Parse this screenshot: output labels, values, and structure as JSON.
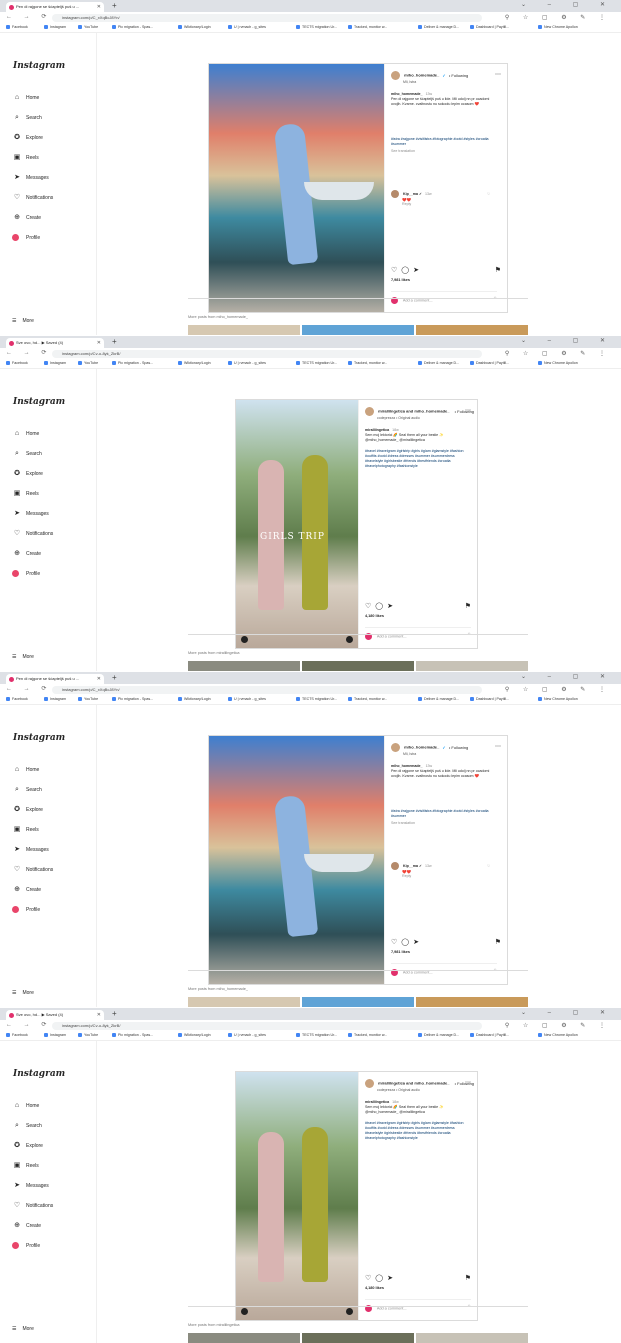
{
  "frames": [
    {
      "tab_title": "Pen di rajgone se šćapteljš puš u ...",
      "url": "instagram.com/p/C_xXqBcJ8Yn/",
      "post_user": "miho_homemade_",
      "post_verified": "✓",
      "follow": "• Following",
      "post_sub": "Mli, Istra",
      "caption_user": "miho_homemade_",
      "caption_time": "13w",
      "caption": "Pen di rajgone se šćapteljš puš u lide. Mli udolj nn pr ocadomi ovojih. Kvarne. cvaltnostu nu sokoolu lepim ocasom ❤️",
      "caption_tags": "#istra #rajgone #visitiistra #fotographie #ootd #styles #croatia #summer",
      "see_translation": "See translation",
      "reply_user": "Kip__ma ✓",
      "reply_time": "13w",
      "reply_emoji": "❤️❤️",
      "reply_link": "Reply",
      "likes": "7,981 likes",
      "comment_placeholder": "Add a comment...",
      "more_from": "More posts from miho_homemade_"
    },
    {
      "tab_title": "Sve ovo, hd... ▶ Saved (4)",
      "url": "instagram.com/p/Cv-o-8yk_ZkrB/",
      "post_user": "mirallilngetica and miho_homemade_",
      "post_verified": "",
      "follow": "• Following",
      "post_sub": "codeprezza • Original audio",
      "caption_user": "mirallilngetica",
      "caption_time": "18w",
      "caption": "Sem moj lektorici 🌈 Seal them all your bestie ✨ @miho_homemade_ @mirallilngetica",
      "caption_tags": "#travel #travelgram #girlstrip #girls #glam #glamstyle #fashion #outfits #ootd #dress #dresses #summer #summerdress #travelstyle #girlsbestie #friends #bestfriends #croatia #travelphotography #fashionstyle",
      "see_translation": "",
      "reply_user": "",
      "reply_time": "",
      "reply_emoji": "",
      "reply_link": "",
      "likes": "4,180 likes",
      "comment_placeholder": "Add a comment...",
      "more_from": "More posts from mirallilngetica",
      "overlay": "GIRLS TRIP"
    },
    {
      "tab_title": "Pen di rajgone se šćapteljš puš u ...",
      "url": "instagram.com/p/C_xXqBcJ8Yn/",
      "post_user": "miho_homemade_",
      "post_verified": "✓",
      "follow": "• Following",
      "post_sub": "Mli, Istra",
      "caption_user": "miho_homemade_",
      "caption_time": "13w",
      "caption": "Pen di rajgone se šćapteljš puš u lide. Mli udolj nn pr ocadomi ovojih. Kvarne. cvaltnostu nu sokoolu lepim ocasom ❤️",
      "caption_tags": "#istra #rajgone #visitiistra #fotographie #ootd #styles #croatia #summer",
      "see_translation": "See translation",
      "reply_user": "Kip__ma ✓",
      "reply_time": "13w",
      "reply_emoji": "❤️❤️",
      "reply_link": "Reply",
      "likes": "7,981 likes",
      "comment_placeholder": "Add a comment...",
      "more_from": "More posts from miho_homemade_"
    },
    {
      "tab_title": "Sve ovo, hd... ▶ Saved (4)",
      "url": "instagram.com/p/Cv-o-8yk_ZkrB/",
      "post_user": "mirallilngetica and miho_homemade_",
      "post_verified": "",
      "follow": "• Following",
      "post_sub": "codeprezza • Original audio",
      "caption_user": "mirallilngetica",
      "caption_time": "18w",
      "caption": "Sem moj lektorici 🌈 Seal them all your bestie ✨ @miho_homemade_ @mirallilngetica",
      "caption_tags": "#travel #travelgram #girlstrip #girls #glam #glamstyle #fashion #outfits #ootd #dress #dresses #summer #summerdress #travelstyle #girlsbestie #friends #bestfriends #croatia #travelphotography #fashionstyle",
      "see_translation": "",
      "reply_user": "",
      "reply_time": "",
      "reply_emoji": "",
      "reply_link": "",
      "likes": "4,180 likes",
      "comment_placeholder": "Add a comment...",
      "more_from": "More posts from mirallilngetica",
      "overlay": ""
    }
  ],
  "bookmarks": [
    "Facebook",
    "Instagram",
    "YouTube",
    "Pic migration - Spas...",
    "Wiktionary/Login",
    "U | rvmach - g_sites",
    "TECTS migration Ur...",
    "Tracked, monitor w...",
    "Deliver & manage D...",
    "Dashboard | Paytill...",
    "New Chrome Apollon"
  ],
  "brand": "Instagram",
  "nav": [
    {
      "icon": "⌂",
      "label": "Home"
    },
    {
      "icon": "⌕",
      "label": "Search"
    },
    {
      "icon": "✪",
      "label": "Explore"
    },
    {
      "icon": "▣",
      "label": "Reels"
    },
    {
      "icon": "➤",
      "label": "Messages"
    },
    {
      "icon": "♡",
      "label": "Notifications"
    },
    {
      "icon": "⊕",
      "label": "Create"
    },
    {
      "icon": "",
      "label": "Profile"
    }
  ],
  "more": "More",
  "colors": {
    "accent": "#0095f6",
    "ig_pink": "#e1306c",
    "tabbar": "#dee1e6"
  }
}
